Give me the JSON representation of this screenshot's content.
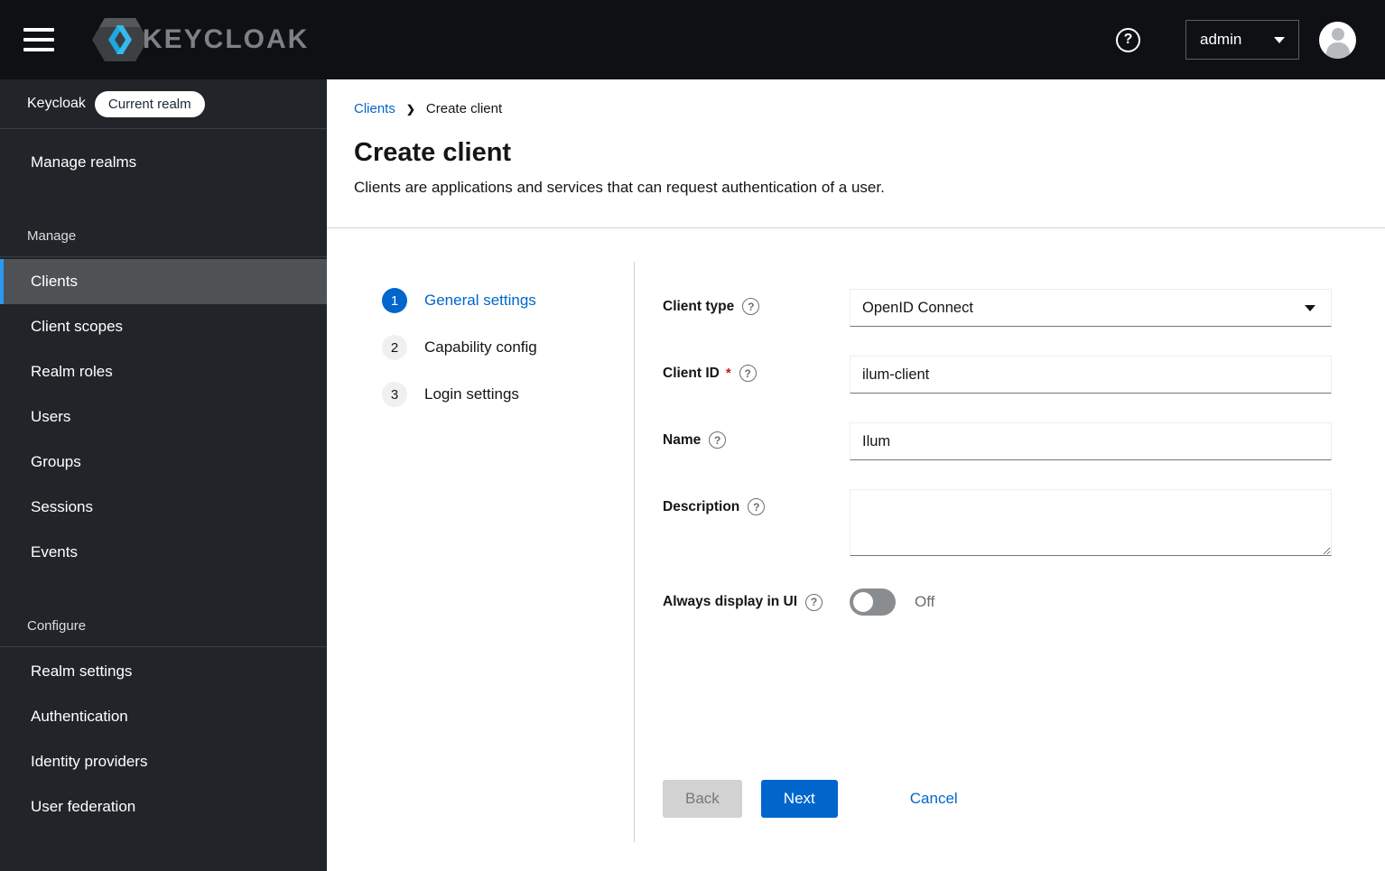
{
  "masthead": {
    "brand": "KEYCLOAK",
    "help_icon": "?",
    "user_menu": {
      "label": "admin"
    }
  },
  "sidebar": {
    "realm": {
      "name": "Keycloak",
      "badge": "Current realm"
    },
    "top_items": [
      {
        "label": "Manage realms"
      }
    ],
    "sections": [
      {
        "heading": "Manage",
        "items": [
          {
            "label": "Clients",
            "selected": true
          },
          {
            "label": "Client scopes"
          },
          {
            "label": "Realm roles"
          },
          {
            "label": "Users"
          },
          {
            "label": "Groups"
          },
          {
            "label": "Sessions"
          },
          {
            "label": "Events"
          }
        ]
      },
      {
        "heading": "Configure",
        "items": [
          {
            "label": "Realm settings"
          },
          {
            "label": "Authentication"
          },
          {
            "label": "Identity providers"
          },
          {
            "label": "User federation"
          }
        ]
      }
    ]
  },
  "breadcrumb": {
    "parent": "Clients",
    "separator": "❯",
    "current": "Create client"
  },
  "page": {
    "title": "Create client",
    "subtitle": "Clients are applications and services that can request authentication of a user."
  },
  "wizard": {
    "steps": [
      {
        "number": "1",
        "label": "General settings",
        "active": true
      },
      {
        "number": "2",
        "label": "Capability config",
        "active": false
      },
      {
        "number": "3",
        "label": "Login settings",
        "active": false
      }
    ]
  },
  "form": {
    "client_type": {
      "label": "Client type",
      "value": "OpenID Connect"
    },
    "client_id": {
      "label": "Client ID",
      "required_marker": "*",
      "value": "ilum-client"
    },
    "name": {
      "label": "Name",
      "value": "Ilum"
    },
    "description": {
      "label": "Description",
      "value": ""
    },
    "always_display_in_ui": {
      "label": "Always display in UI",
      "value": "Off"
    }
  },
  "actions": {
    "back": "Back",
    "next": "Next",
    "cancel": "Cancel"
  },
  "colors": {
    "primary": "#0066cc",
    "masthead_bg": "#0e1013",
    "sidebar_bg": "#212428",
    "sidebar_selected_bg": "#4f5255",
    "sidebar_accent": "#2b9af3",
    "divider": "#d2d2d2",
    "danger": "#c9190b",
    "toggle_off": "#8a8d90"
  }
}
